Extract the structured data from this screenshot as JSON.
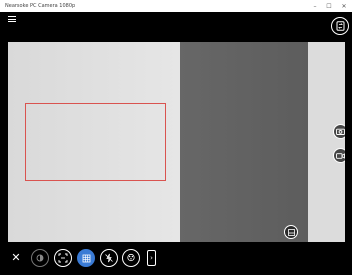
{
  "window": {
    "title": "Nearsoke PC Camera 1080p",
    "controls": {
      "minimize": "–",
      "maximize": "☐",
      "close": "✕"
    }
  },
  "appbar": {
    "menu_icon": "hamburger-icon",
    "switch_camera_icon": "switch-camera-icon"
  },
  "viewfinder": {
    "face_box_color": "#d9534f",
    "side_buttons": [
      "photo-mode-icon",
      "video-mode-icon"
    ],
    "mini_button_icon": "timer-icon"
  },
  "bottombar": {
    "close": "✕",
    "tools": [
      "hdr-icon",
      "scan-icon",
      "grid-icon",
      "no-flash-icon",
      "filter-icon"
    ],
    "active_tool": "grid-icon",
    "active_color": "#3a7bd5",
    "more": "›"
  }
}
